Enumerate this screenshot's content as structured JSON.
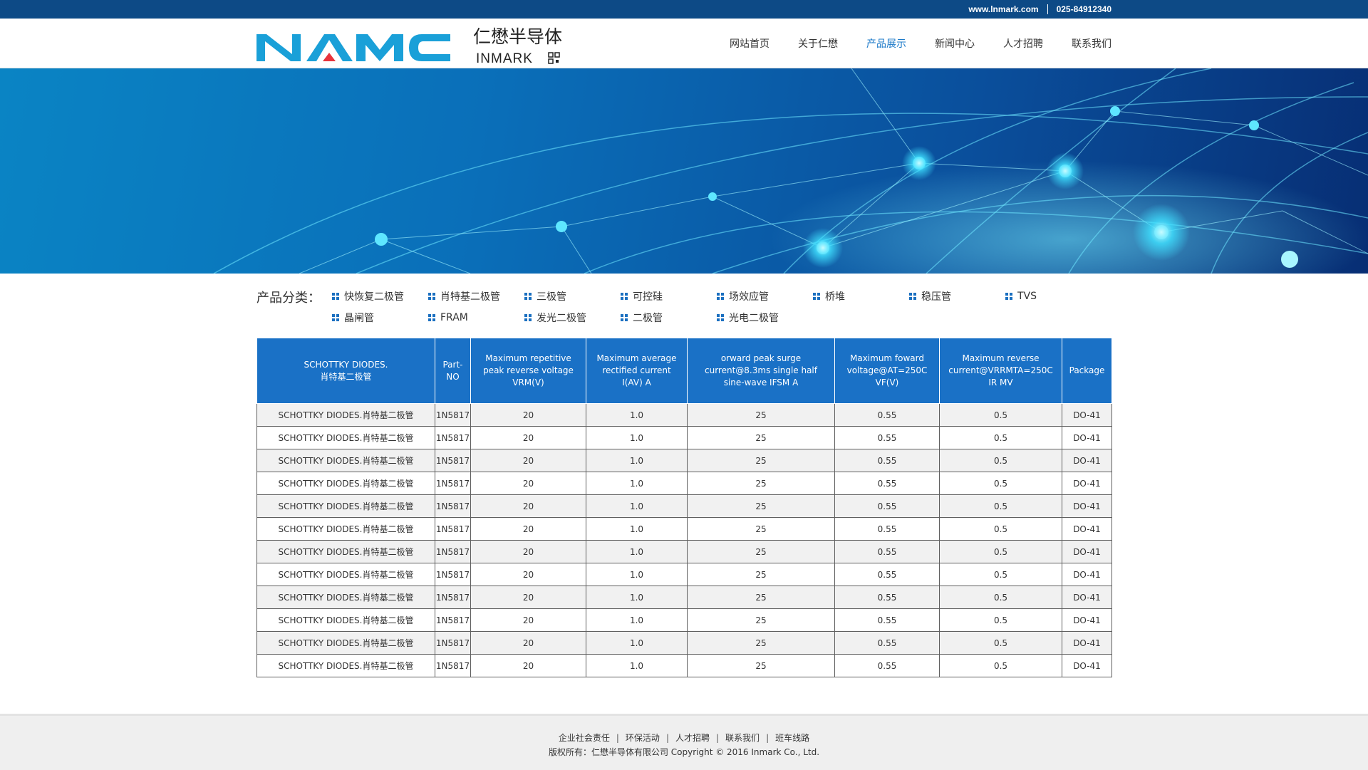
{
  "topbar": {
    "website": "www.lnmark.com",
    "phone": "025-84912340"
  },
  "logo": {
    "brand": "NAMC",
    "cn_name": "仁懋半导体",
    "en_name": "INMARK"
  },
  "nav": [
    {
      "label": "网站首页"
    },
    {
      "label": "关于仁懋"
    },
    {
      "label": "产品展示",
      "active": true
    },
    {
      "label": "新闻中心"
    },
    {
      "label": "人才招聘"
    },
    {
      "label": "联系我们"
    }
  ],
  "categories": {
    "label": "产品分类：",
    "items": [
      "快恢复二极管",
      "肖特基二极管",
      "三极管",
      "可控硅",
      "场效应管",
      "桥堆",
      "稳压管",
      "TVS",
      "晶闸管",
      "FRAM",
      "发光二极管",
      "二极管",
      "光电二极管"
    ]
  },
  "table": {
    "headers": [
      "SCHOTTKY DIODES.\n肖特基二极管",
      "Part-\nNO",
      "Maximum repetitive peak reverse voltage VRM(V)",
      "Maximum average rectified current I(AV) A",
      "orward peak surge current@8.3ms single half sine-wave IFSM A",
      "Maximum foward voltage@AT=250C VF(V)",
      "Maximum reverse current@VRRMTA=250C IR MV",
      "Package"
    ],
    "rows": [
      [
        "SCHOTTKY DIODES.肖特基二极管",
        "1N5817",
        "20",
        "1.0",
        "25",
        "0.55",
        "0.5",
        "DO-41"
      ],
      [
        "SCHOTTKY DIODES.肖特基二极管",
        "1N5817",
        "20",
        "1.0",
        "25",
        "0.55",
        "0.5",
        "DO-41"
      ],
      [
        "SCHOTTKY DIODES.肖特基二极管",
        "1N5817",
        "20",
        "1.0",
        "25",
        "0.55",
        "0.5",
        "DO-41"
      ],
      [
        "SCHOTTKY DIODES.肖特基二极管",
        "1N5817",
        "20",
        "1.0",
        "25",
        "0.55",
        "0.5",
        "DO-41"
      ],
      [
        "SCHOTTKY DIODES.肖特基二极管",
        "1N5817",
        "20",
        "1.0",
        "25",
        "0.55",
        "0.5",
        "DO-41"
      ],
      [
        "SCHOTTKY DIODES.肖特基二极管",
        "1N5817",
        "20",
        "1.0",
        "25",
        "0.55",
        "0.5",
        "DO-41"
      ],
      [
        "SCHOTTKY DIODES.肖特基二极管",
        "1N5817",
        "20",
        "1.0",
        "25",
        "0.55",
        "0.5",
        "DO-41"
      ],
      [
        "SCHOTTKY DIODES.肖特基二极管",
        "1N5817",
        "20",
        "1.0",
        "25",
        "0.55",
        "0.5",
        "DO-41"
      ],
      [
        "SCHOTTKY DIODES.肖特基二极管",
        "1N5817",
        "20",
        "1.0",
        "25",
        "0.55",
        "0.5",
        "DO-41"
      ],
      [
        "SCHOTTKY DIODES.肖特基二极管",
        "1N5817",
        "20",
        "1.0",
        "25",
        "0.55",
        "0.5",
        "DO-41"
      ],
      [
        "SCHOTTKY DIODES.肖特基二极管",
        "1N5817",
        "20",
        "1.0",
        "25",
        "0.55",
        "0.5",
        "DO-41"
      ],
      [
        "SCHOTTKY DIODES.肖特基二极管",
        "1N5817",
        "20",
        "1.0",
        "25",
        "0.55",
        "0.5",
        "DO-41"
      ]
    ]
  },
  "footer": {
    "links": [
      "企业社会责任",
      "环保活动",
      "人才招聘",
      "联系我们",
      "班车线路"
    ],
    "copyright": "版权所有：仁懋半导体有限公司 Copyright © 2016 Inmark Co., Ltd."
  },
  "colors": {
    "primary": "#1a71c6",
    "topbar": "#0d4a86",
    "nav_active": "#1a78c8",
    "logo_cyan": "#1aa0d8",
    "logo_red": "#e8343c"
  },
  "icons": {
    "category_bullet": "grid-square-icon",
    "qr": "qr-icon"
  }
}
